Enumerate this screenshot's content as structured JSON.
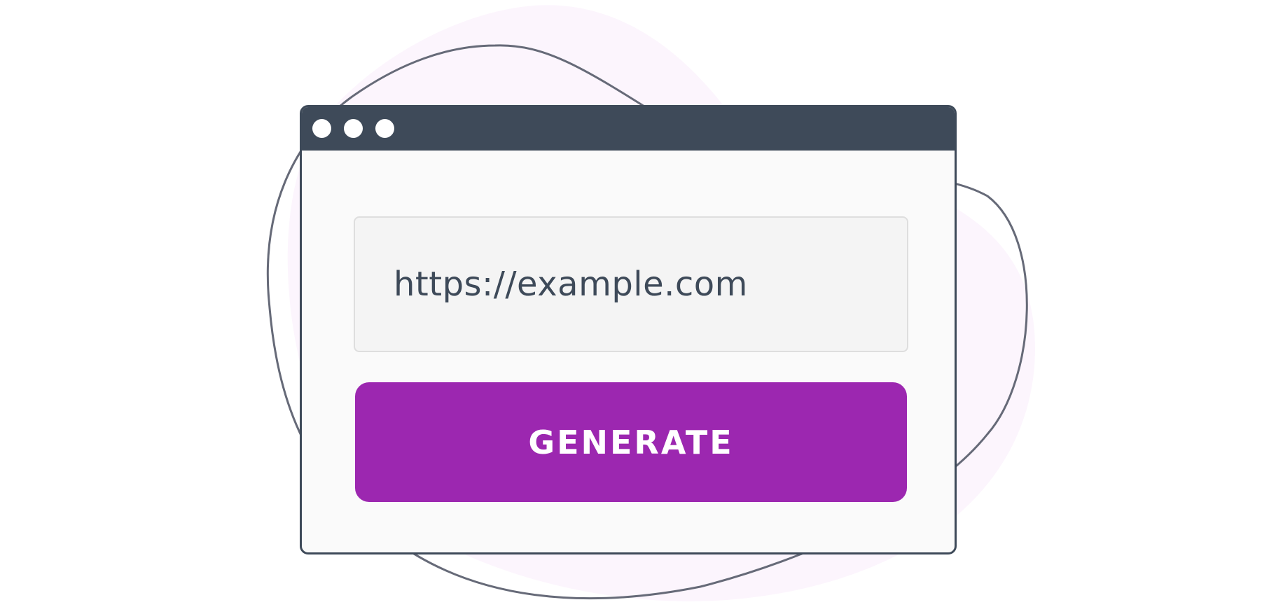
{
  "colors": {
    "window_frame": "#3e4a59",
    "window_body": "#fafafa",
    "input_background": "#f4f4f4",
    "input_border": "#dedede",
    "button_background": "#9c27b0",
    "button_text": "#ffffff",
    "background_blob": "#fcf5fd",
    "outline_stroke": "#666a78"
  },
  "window": {
    "controls": [
      "dot",
      "dot",
      "dot"
    ]
  },
  "form": {
    "url_value": "https://example.com",
    "generate_label": "GENERATE"
  }
}
